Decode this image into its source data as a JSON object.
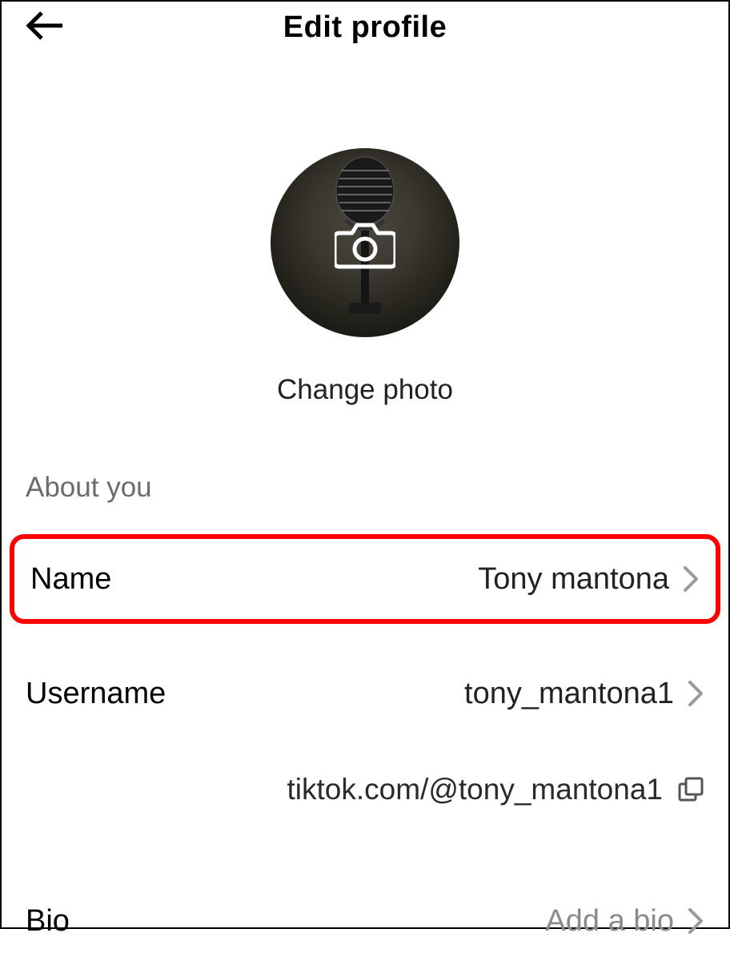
{
  "header": {
    "title": "Edit profile"
  },
  "avatar": {
    "change_label": "Change photo"
  },
  "section": {
    "about": "About you"
  },
  "rows": {
    "name": {
      "label": "Name",
      "value": "Tony mantona"
    },
    "username": {
      "label": "Username",
      "value": "tony_mantona1"
    },
    "url": {
      "text": "tiktok.com/@tony_mantona1"
    },
    "bio": {
      "label": "Bio",
      "placeholder": "Add a bio"
    }
  }
}
